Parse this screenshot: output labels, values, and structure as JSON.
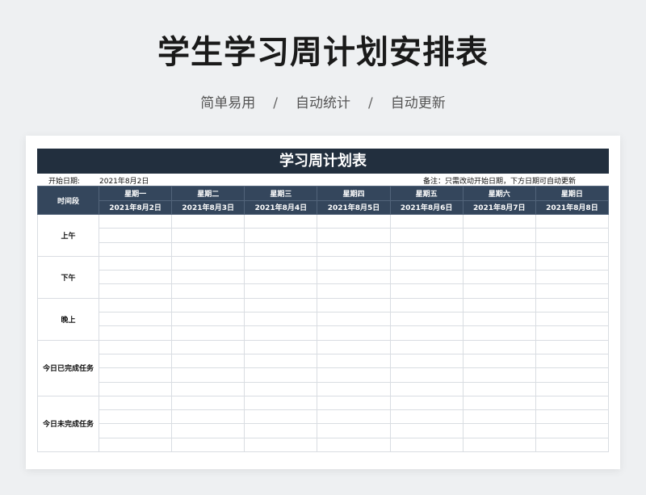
{
  "header": {
    "title": "学生学习周计划安排表",
    "features": [
      "简单易用",
      "自动统计",
      "自动更新"
    ],
    "separator": "/"
  },
  "sheet": {
    "title": "学习周计划表",
    "start_label": "开始日期:",
    "start_value": "2021年8月2日",
    "note": "备注：只需改动开始日期，下方日期可自动更新",
    "period_header": "时间段",
    "days": [
      {
        "weekday": "星期一",
        "date": "2021年8月2日"
      },
      {
        "weekday": "星期二",
        "date": "2021年8月3日"
      },
      {
        "weekday": "星期三",
        "date": "2021年8月4日"
      },
      {
        "weekday": "星期四",
        "date": "2021年8月5日"
      },
      {
        "weekday": "星期五",
        "date": "2021年8月6日"
      },
      {
        "weekday": "星期六",
        "date": "2021年8月7日"
      },
      {
        "weekday": "星期日",
        "date": "2021年8月8日"
      }
    ],
    "periods": [
      {
        "label": "上午",
        "rows": 3
      },
      {
        "label": "下午",
        "rows": 3
      },
      {
        "label": "晚上",
        "rows": 3
      },
      {
        "label": "今日已完成任务",
        "rows": 4
      },
      {
        "label": "今日未完成任务",
        "rows": 4
      }
    ]
  }
}
